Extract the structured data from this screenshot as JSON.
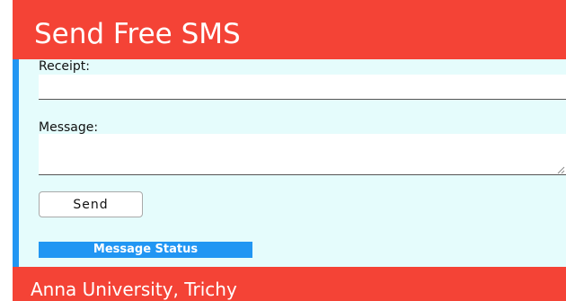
{
  "header": {
    "title": "Send Free SMS"
  },
  "form": {
    "recipient_label": "Receipt:",
    "recipient_value": "",
    "message_label": "Message:",
    "message_value": "",
    "send_label": "Send"
  },
  "status": {
    "label": "Message Status"
  },
  "footer": {
    "text": "Anna University, Trichy"
  },
  "colors": {
    "header_bg": "#f44336",
    "panel_bg": "#e5fcfc",
    "accent_blue": "#2196f3",
    "footer_bg": "#f44336"
  },
  "icons": {
    "resize_grip": "resize-grip-icon"
  }
}
